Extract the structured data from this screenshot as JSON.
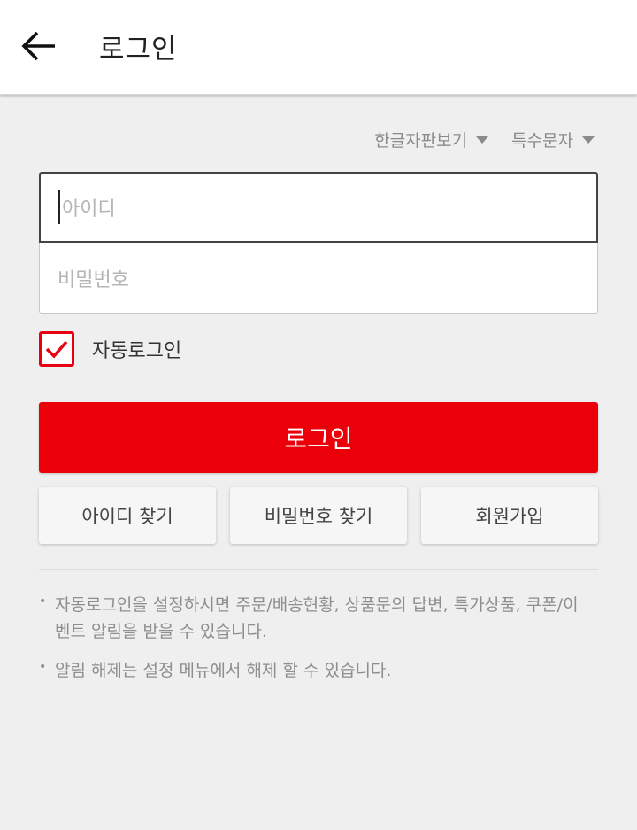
{
  "header": {
    "title": "로그인",
    "back_icon": "arrow-left-icon"
  },
  "options": {
    "keyboard_view": "한글자판보기",
    "special_chars": "특수문자"
  },
  "form": {
    "id_placeholder": "아이디",
    "password_placeholder": "비밀번호",
    "auto_login_label": "자동로그인",
    "auto_login_checked": true,
    "login_button": "로그인"
  },
  "links": {
    "find_id": "아이디 찾기",
    "find_password": "비밀번호 찾기",
    "signup": "회원가입"
  },
  "notes": [
    "자동로그인을 설정하시면 주문/배송현황, 상품문의 답변, 특가상품, 쿠폰/이벤트 알림을 받을 수 있습니다.",
    "알림 해제는 설정 메뉴에서 해제 할 수 있습니다."
  ],
  "colors": {
    "accent": "#eb0009",
    "background": "#efefef"
  }
}
